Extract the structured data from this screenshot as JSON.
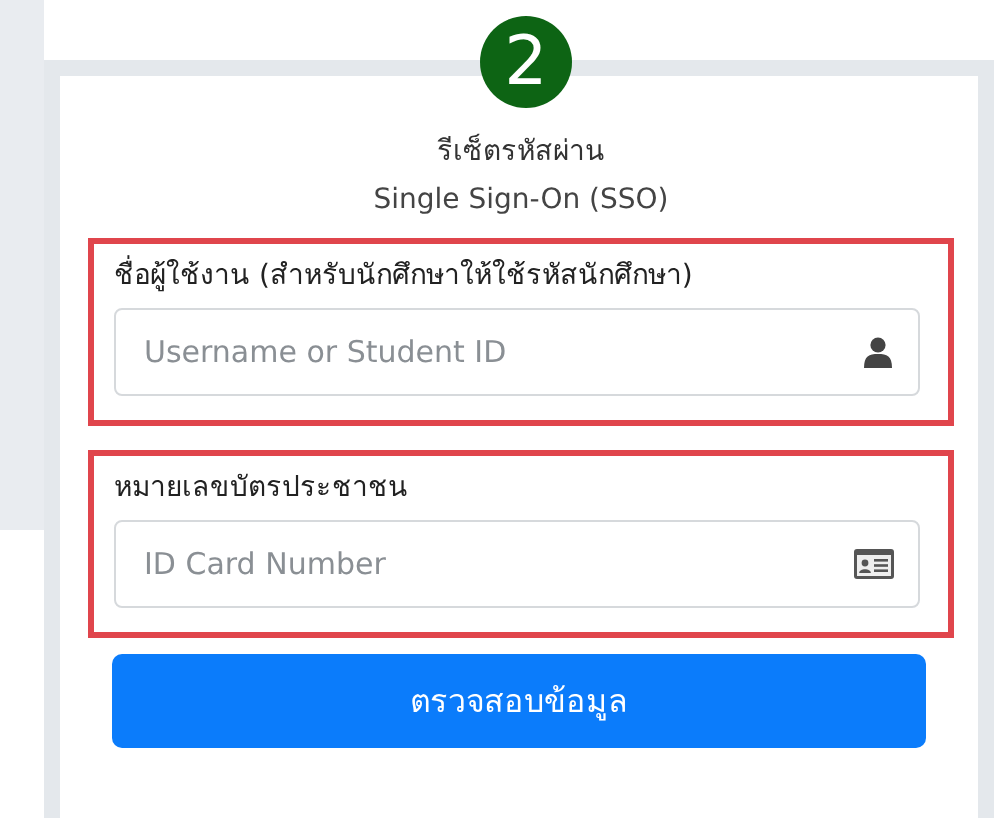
{
  "step_badge": "2",
  "card": {
    "title": "รีเซ็ตรหัสผ่าน",
    "subtitle": "Single Sign-On (SSO)"
  },
  "fields": [
    {
      "label": "ชื่อผู้ใช้งาน (สำหรับนักศึกษาให้ใช้รหัสนักศึกษา)",
      "placeholder": "Username or Student ID",
      "kind": "user",
      "highlighted": true
    },
    {
      "label": "หมายเลขบัตรประชาชน",
      "placeholder": "ID Card Number",
      "kind": "id-card",
      "highlighted": true
    }
  ],
  "button": "ตรวจสอบข้อมูล"
}
